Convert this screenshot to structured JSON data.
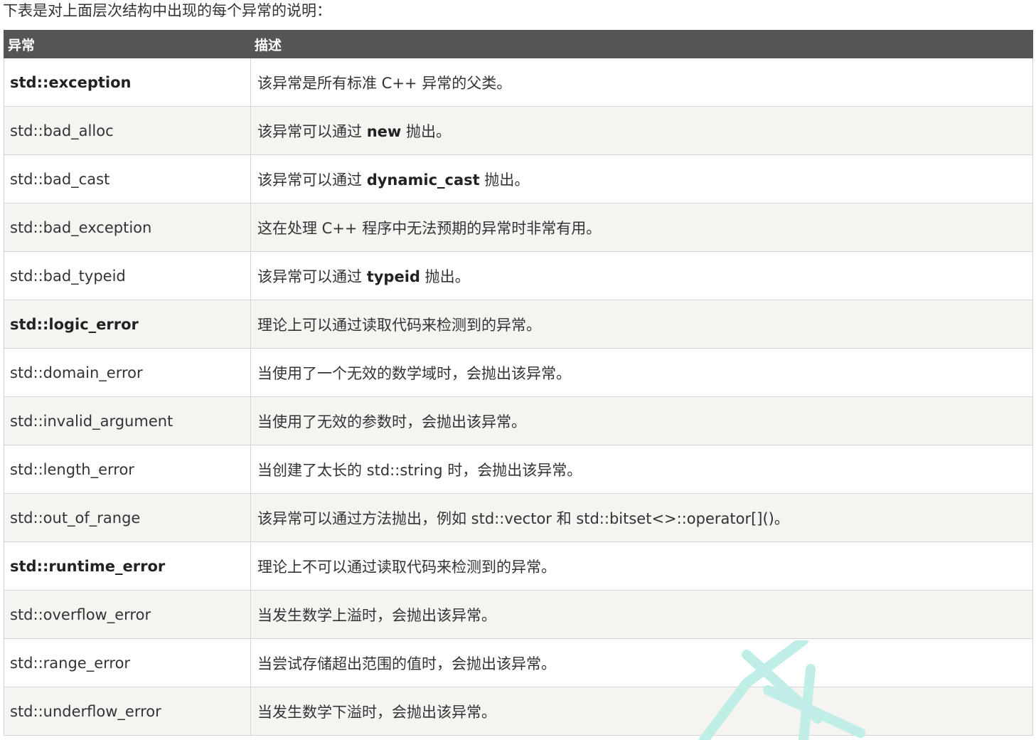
{
  "intro_text": "下表是对上面层次结构中出现的每个异常的说明：",
  "table": {
    "headers": [
      "异常",
      "描述"
    ],
    "rows": [
      {
        "name": "std::exception",
        "name_bold": true,
        "desc_before": "该异常是所有标准 C++ 异常的父类。",
        "desc_bold": "",
        "desc_after": ""
      },
      {
        "name": "std::bad_alloc",
        "name_bold": false,
        "desc_before": "该异常可以通过 ",
        "desc_bold": "new",
        "desc_after": " 抛出。"
      },
      {
        "name": "std::bad_cast",
        "name_bold": false,
        "desc_before": "该异常可以通过 ",
        "desc_bold": "dynamic_cast",
        "desc_after": " 抛出。"
      },
      {
        "name": "std::bad_exception",
        "name_bold": false,
        "desc_before": "这在处理 C++ 程序中无法预期的异常时非常有用。",
        "desc_bold": "",
        "desc_after": ""
      },
      {
        "name": "std::bad_typeid",
        "name_bold": false,
        "desc_before": "该异常可以通过 ",
        "desc_bold": "typeid",
        "desc_after": " 抛出。"
      },
      {
        "name": "std::logic_error",
        "name_bold": true,
        "desc_before": "理论上可以通过读取代码来检测到的异常。",
        "desc_bold": "",
        "desc_after": ""
      },
      {
        "name": "std::domain_error",
        "name_bold": false,
        "desc_before": "当使用了一个无效的数学域时，会抛出该异常。",
        "desc_bold": "",
        "desc_after": ""
      },
      {
        "name": "std::invalid_argument",
        "name_bold": false,
        "desc_before": "当使用了无效的参数时，会抛出该异常。",
        "desc_bold": "",
        "desc_after": ""
      },
      {
        "name": "std::length_error",
        "name_bold": false,
        "desc_before": "当创建了太长的 std::string 时，会抛出该异常。",
        "desc_bold": "",
        "desc_after": ""
      },
      {
        "name": "std::out_of_range",
        "name_bold": false,
        "desc_before": "该异常可以通过方法抛出，例如 std::vector 和 std::bitset<>::operator[]()。",
        "desc_bold": "",
        "desc_after": ""
      },
      {
        "name": "std::runtime_error",
        "name_bold": true,
        "desc_before": "理论上不可以通过读取代码来检测到的异常。",
        "desc_bold": "",
        "desc_after": ""
      },
      {
        "name": "std::overflow_error",
        "name_bold": false,
        "desc_before": "当发生数学上溢时，会抛出该异常。",
        "desc_bold": "",
        "desc_after": ""
      },
      {
        "name": "std::range_error",
        "name_bold": false,
        "desc_before": "当尝试存储超出范围的值时，会抛出该异常。",
        "desc_bold": "",
        "desc_after": ""
      },
      {
        "name": "std::underflow_error",
        "name_bold": false,
        "desc_before": "当发生数学下溢时，会抛出该异常。",
        "desc_bold": "",
        "desc_after": ""
      }
    ]
  },
  "colors": {
    "header_bg": "#555555",
    "header_text": "#ffffff",
    "stripe_bg": "#f6f4f0",
    "border": "#d4d4d4",
    "watermark": "#bfeee6"
  }
}
